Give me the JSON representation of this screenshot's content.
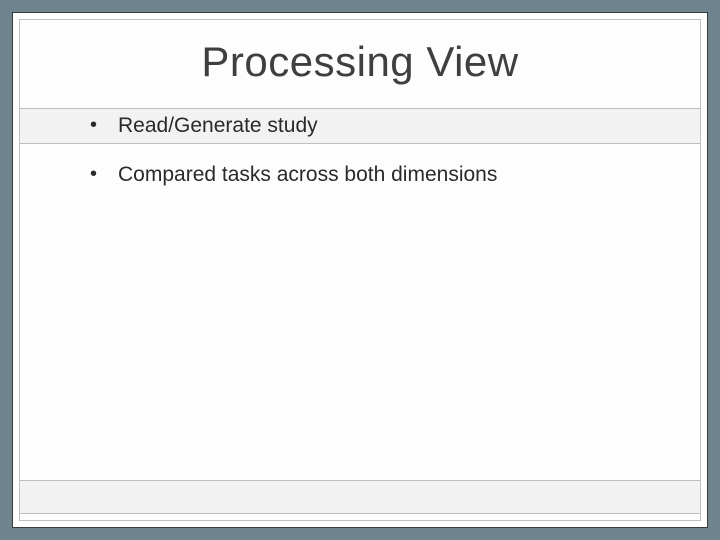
{
  "slide": {
    "title": "Processing View",
    "bullets": [
      "Read/Generate study",
      "Compared tasks across both dimensions"
    ]
  }
}
